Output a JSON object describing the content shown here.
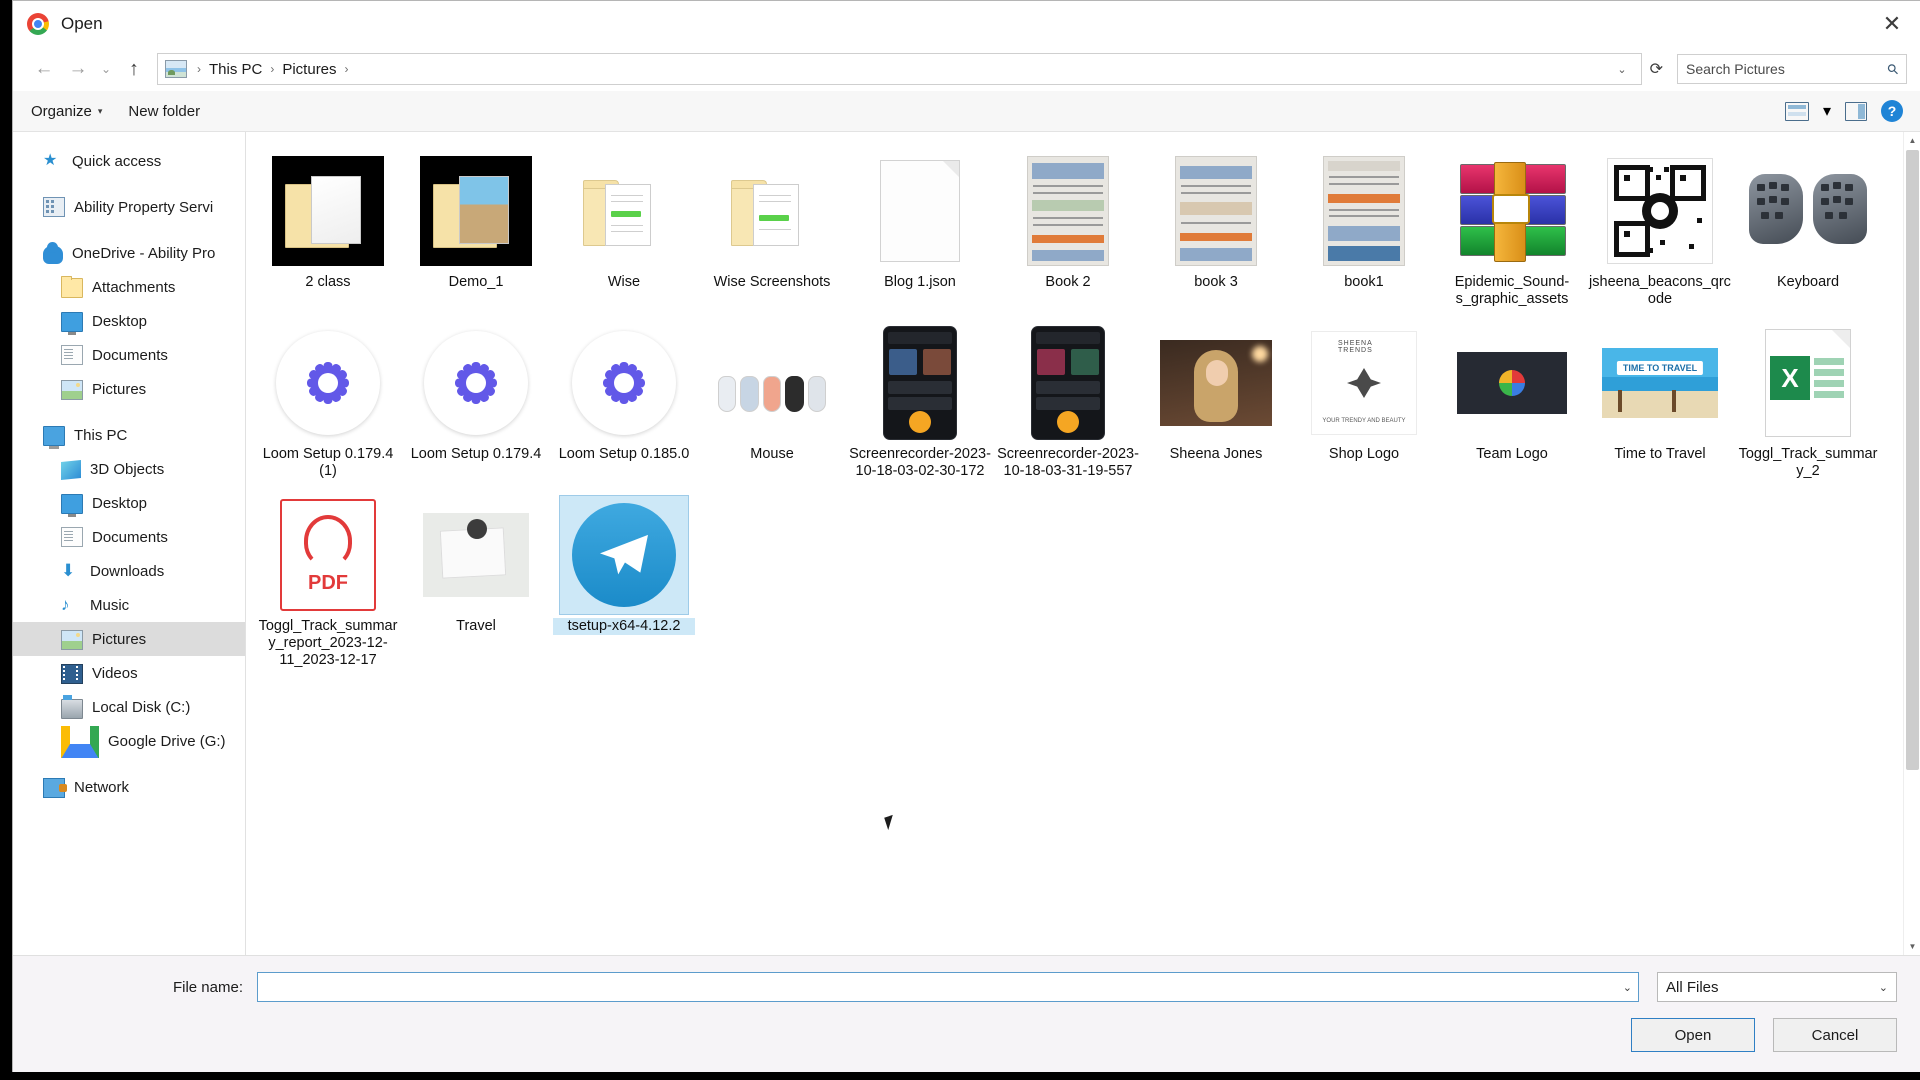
{
  "window": {
    "title": "Open",
    "app_icon": "chrome-logo-icon",
    "close_label": "✕"
  },
  "navigation": {
    "back_label": "←",
    "forward_label": "→",
    "recent_label": "⌄",
    "up_label": "↑",
    "breadcrumb": [
      "This PC",
      "Pictures"
    ],
    "breadcrumb_separator": "›",
    "dropdown_caret": "⌄",
    "refresh_label": "⟳"
  },
  "search": {
    "placeholder": "Search Pictures",
    "icon": "magnifier-icon",
    "icon_glyph": "⚲"
  },
  "command_bar": {
    "organize_label": "Organize",
    "organize_caret": "▾",
    "new_folder_label": "New folder",
    "view_caret": "▾",
    "help_label": "?"
  },
  "sidebar": {
    "items": [
      {
        "label": "Quick access",
        "icon": "star-icon",
        "indent": false,
        "selected": false
      },
      {
        "label": "Ability Property Servi",
        "icon": "building-icon",
        "indent": false,
        "selected": false
      },
      {
        "label": "OneDrive - Ability Pro",
        "icon": "cloud-icon",
        "indent": false,
        "selected": false
      },
      {
        "label": "Attachments",
        "icon": "folder-icon",
        "indent": true,
        "selected": false
      },
      {
        "label": "Desktop",
        "icon": "desktop-icon",
        "indent": true,
        "selected": false
      },
      {
        "label": "Documents",
        "icon": "document-icon",
        "indent": true,
        "selected": false
      },
      {
        "label": "Pictures",
        "icon": "pictures-icon",
        "indent": true,
        "selected": false
      },
      {
        "label": "This PC",
        "icon": "pc-icon",
        "indent": false,
        "selected": false
      },
      {
        "label": "3D Objects",
        "icon": "3d-objects-icon",
        "indent": true,
        "selected": false
      },
      {
        "label": "Desktop",
        "icon": "desktop-icon",
        "indent": true,
        "selected": false
      },
      {
        "label": "Documents",
        "icon": "document-icon",
        "indent": true,
        "selected": false
      },
      {
        "label": "Downloads",
        "icon": "download-icon",
        "indent": true,
        "selected": false
      },
      {
        "label": "Music",
        "icon": "music-icon",
        "indent": true,
        "selected": false
      },
      {
        "label": "Pictures",
        "icon": "pictures-icon",
        "indent": true,
        "selected": true
      },
      {
        "label": "Videos",
        "icon": "video-icon",
        "indent": true,
        "selected": false
      },
      {
        "label": "Local Disk (C:)",
        "icon": "disk-icon",
        "indent": true,
        "selected": false
      },
      {
        "label": "Google Drive (G:)",
        "icon": "google-drive-icon",
        "indent": true,
        "selected": false
      },
      {
        "label": "Network",
        "icon": "network-icon",
        "indent": false,
        "selected": false
      }
    ]
  },
  "files": [
    {
      "name": "2 class",
      "kind": "folder-dark",
      "selected": false
    },
    {
      "name": "Demo_1",
      "kind": "folder-dark-photo",
      "selected": false
    },
    {
      "name": "Wise",
      "kind": "folder-plain",
      "selected": false
    },
    {
      "name": "Wise Screenshots",
      "kind": "folder-plain",
      "selected": false
    },
    {
      "name": "Blog 1.json",
      "kind": "blank-document",
      "selected": false
    },
    {
      "name": "Book 2",
      "kind": "poster-image",
      "selected": false
    },
    {
      "name": "book 3",
      "kind": "poster-image",
      "selected": false
    },
    {
      "name": "book1",
      "kind": "poster-image",
      "selected": false
    },
    {
      "name": "Epidemic_Sound-s_graphic_assets",
      "kind": "winrar-archive",
      "selected": false
    },
    {
      "name": "jsheena_beacons_qrcode",
      "kind": "qr-code",
      "selected": false
    },
    {
      "name": "Keyboard",
      "kind": "keyboard-photo",
      "selected": false
    },
    {
      "name": "Loom Setup 0.179.4 (1)",
      "kind": "loom-installer",
      "selected": false
    },
    {
      "name": "Loom Setup 0.179.4",
      "kind": "loom-installer",
      "selected": false
    },
    {
      "name": "Loom Setup 0.185.0",
      "kind": "loom-installer",
      "selected": false
    },
    {
      "name": "Mouse",
      "kind": "mouse-photo",
      "selected": false
    },
    {
      "name": "Screenrecorder-2023-10-18-03-02-30-172",
      "kind": "phone-screenshot",
      "selected": false
    },
    {
      "name": "Screenrecorder-2023-10-18-03-31-19-557",
      "kind": "phone-screenshot",
      "selected": false
    },
    {
      "name": "Sheena Jones",
      "kind": "portrait-photo",
      "selected": false
    },
    {
      "name": "Shop Logo",
      "kind": "shop-logo",
      "selected": false
    },
    {
      "name": "Team Logo",
      "kind": "team-logo",
      "selected": false
    },
    {
      "name": "Time to Travel",
      "kind": "travel-banner",
      "selected": false
    },
    {
      "name": "Toggl_Track_summary_2",
      "kind": "excel-document",
      "selected": false
    },
    {
      "name": "Toggl_Track_summary_report_2023-12-11_2023-12-17",
      "kind": "pdf-document",
      "selected": false
    },
    {
      "name": "Travel",
      "kind": "travel-photo",
      "selected": false
    },
    {
      "name": "tsetup-x64-4.12.2",
      "kind": "telegram-installer",
      "selected": true
    }
  ],
  "footer": {
    "file_name_label": "File name:",
    "file_name_value": "",
    "file_name_caret": "⌄",
    "filter_value": "All Files",
    "filter_caret": "⌄",
    "open_label": "Open",
    "cancel_label": "Cancel"
  },
  "colors": {
    "loom_purple": "#6258e8",
    "telegram_blue": "#2f9ad8",
    "selection_blue": "#cde8f7",
    "accent_blue": "#2f7fc4",
    "pdf_red": "#e23a3a",
    "excel_green": "#1d8a4c"
  }
}
